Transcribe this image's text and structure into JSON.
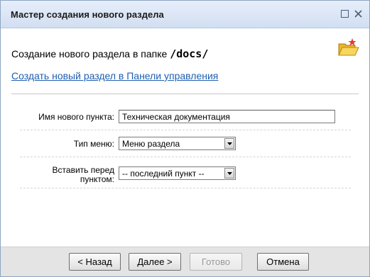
{
  "window": {
    "title": "Мастер создания нового раздела",
    "controls": [
      "maximize-icon",
      "close-icon"
    ]
  },
  "header": {
    "heading_prefix": "Создание нового раздела в папке",
    "folder_path": "/docs/",
    "icon": "new-folder-icon"
  },
  "link": {
    "control_panel": "Создать новый раздел в Панели управления"
  },
  "form": {
    "item_name_label": "Имя нового пункта:",
    "item_name_value": "Техническая документация",
    "menu_type_label": "Тип меню:",
    "menu_type_value": "Меню раздела",
    "insert_before_label_line1": "Вставить перед",
    "insert_before_label_line2": "пунктом:",
    "insert_before_value": "-- последний пункт --"
  },
  "buttons": {
    "back": "< Назад",
    "next": "Далее >",
    "finish": "Готово",
    "cancel": "Отмена"
  },
  "colors": {
    "titlebar": "#d2dff1",
    "link": "#1f5fb0",
    "footer": "#e4e4e4"
  }
}
